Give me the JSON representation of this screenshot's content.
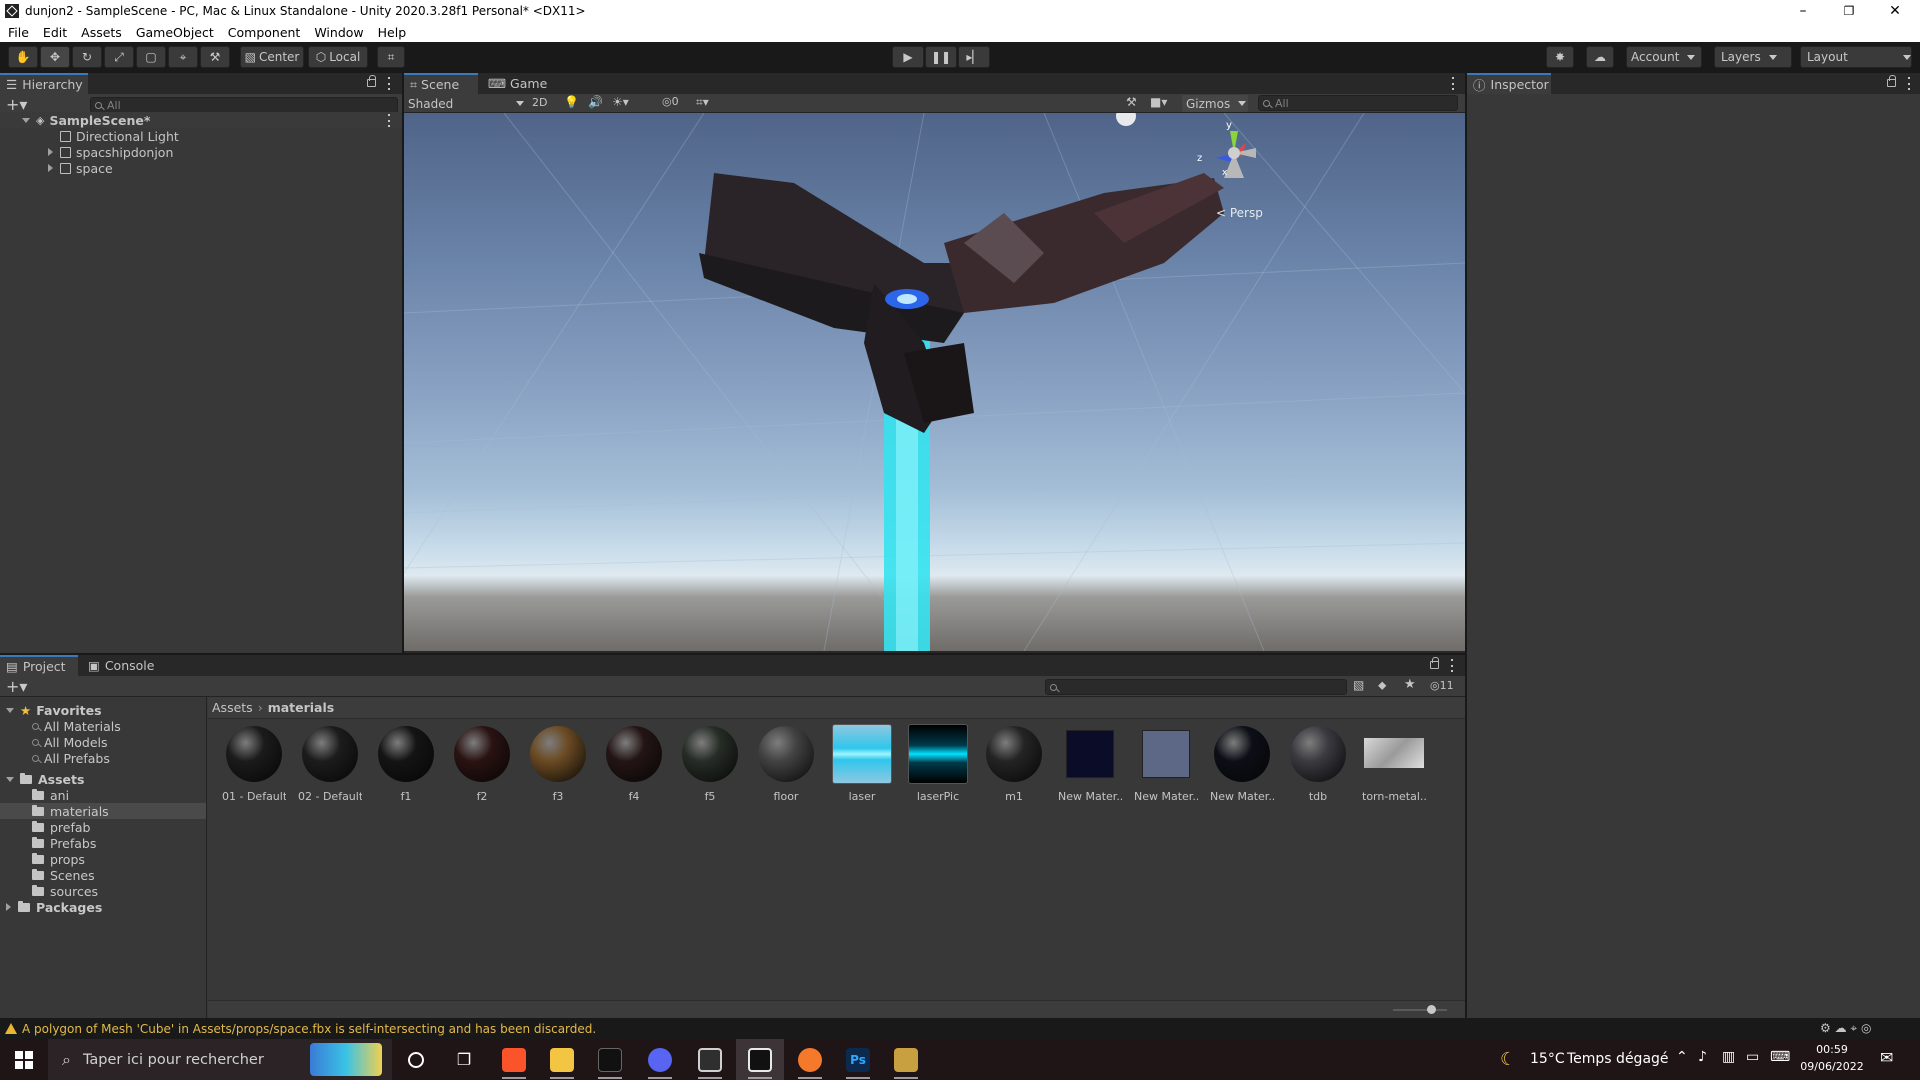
{
  "window": {
    "title": "dunjon2 - SampleScene - PC, Mac & Linux Standalone - Unity 2020.3.28f1 Personal* <DX11>"
  },
  "menu": [
    "File",
    "Edit",
    "Assets",
    "GameObject",
    "Component",
    "Window",
    "Help"
  ],
  "toolbar": {
    "pivot": "Center",
    "space": "Local",
    "account": "Account",
    "layers": "Layers",
    "layout": "Layout"
  },
  "hierarchy": {
    "tab": "Hierarchy",
    "search_placeholder": "All",
    "scene": "SampleScene*",
    "items": [
      "Directional Light",
      "spacshipdonjon",
      "space"
    ]
  },
  "scene_view": {
    "tabs": [
      "Scene",
      "Game"
    ],
    "shading": "Shaded",
    "mode_2d": "2D",
    "hidden_count": "0",
    "gizmos": "Gizmos",
    "search_placeholder": "All",
    "projection": "< Persp",
    "axes": {
      "y": "y",
      "x": "x",
      "z": "z"
    }
  },
  "inspector": {
    "tab": "Inspector"
  },
  "project": {
    "tabs": [
      "Project",
      "Console"
    ],
    "hidden_count": "11",
    "favorites": {
      "label": "Favorites",
      "items": [
        "All Materials",
        "All Models",
        "All Prefabs"
      ]
    },
    "assets": {
      "label": "Assets",
      "folders": [
        "ani",
        "materials",
        "prefab",
        "Prefabs",
        "props",
        "Scenes",
        "sources"
      ],
      "selected": "materials"
    },
    "packages": "Packages",
    "breadcrumb": [
      "Assets",
      "materials"
    ],
    "materials": [
      {
        "name": "01 - Default",
        "color": "#1b1b1b"
      },
      {
        "name": "02 - Default",
        "color": "#1c1c1c"
      },
      {
        "name": "f1",
        "color": "#141414"
      },
      {
        "name": "f2",
        "color": "#2a1212"
      },
      {
        "name": "f3",
        "color": "#6a4a22"
      },
      {
        "name": "f4",
        "color": "#241515"
      },
      {
        "name": "f5",
        "color": "#262c26"
      },
      {
        "name": "floor",
        "color": "#424242"
      },
      {
        "name": "laser",
        "color": "#45c6e6"
      },
      {
        "name": "laserPic",
        "color": "#00d6ff"
      },
      {
        "name": "m1",
        "color": "#242424"
      },
      {
        "name": "New Mater...",
        "color": "#0a0c28"
      },
      {
        "name": "New Mater...",
        "color": "#5d6886"
      },
      {
        "name": "New Mater...",
        "color": "#0c0f16"
      },
      {
        "name": "tdb",
        "color": "#3a3a40"
      },
      {
        "name": "torn-metal...",
        "color": "#bdbdbd"
      }
    ]
  },
  "status": {
    "message": "A polygon of Mesh 'Cube' in Assets/props/space.fbx is self-intersecting and has been discarded."
  },
  "taskbar": {
    "search_placeholder": "Taper ici pour rechercher",
    "weather_temp": "15°C",
    "weather_text": "Temps dégagé",
    "time": "00:59",
    "date": "09/06/2022",
    "apps": [
      "task-view",
      "brave",
      "file-explorer",
      "terminal",
      "discord",
      "unity-hub",
      "unity",
      "blender",
      "photoshop",
      "league"
    ]
  }
}
